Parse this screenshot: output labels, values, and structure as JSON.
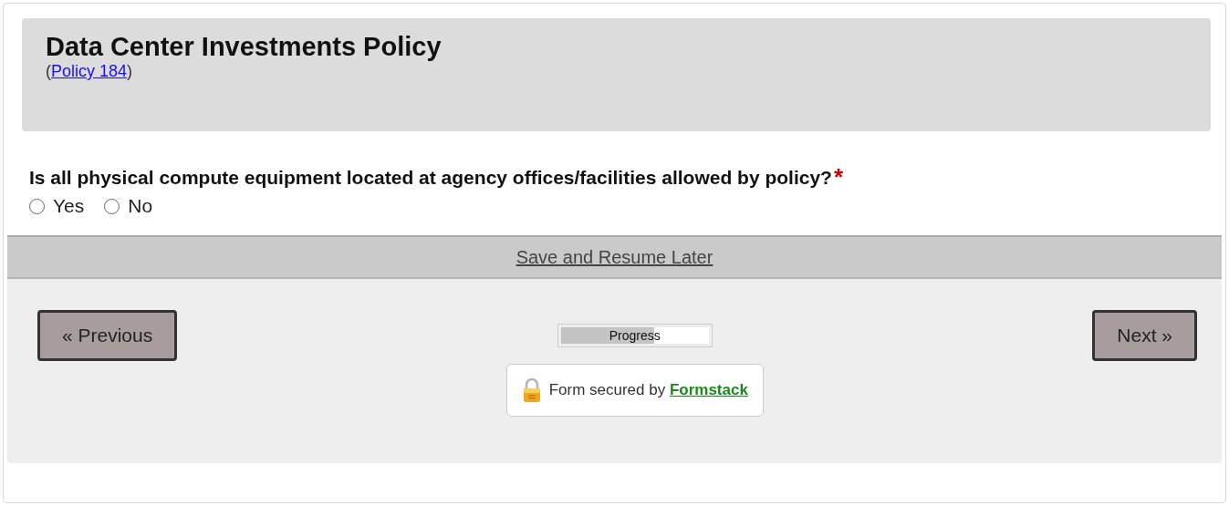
{
  "header": {
    "title": "Data Center Investments Policy",
    "reference": {
      "before": "(",
      "link": "Policy 184",
      "after": ")"
    }
  },
  "question": {
    "label": "Is all physical compute equipment located at agency offices/facilities allowed by policy?",
    "required_mark": "*",
    "options": [
      {
        "label": "Yes",
        "selected": false
      },
      {
        "label": "No",
        "selected": false
      }
    ]
  },
  "save_link": "Save and Resume Later",
  "navigation": {
    "previous": "« Previous",
    "next": "Next »"
  },
  "progress": {
    "label": "Progress",
    "level": 0.61
  },
  "security": {
    "text": "Form secured by ",
    "link": "Formstack"
  }
}
